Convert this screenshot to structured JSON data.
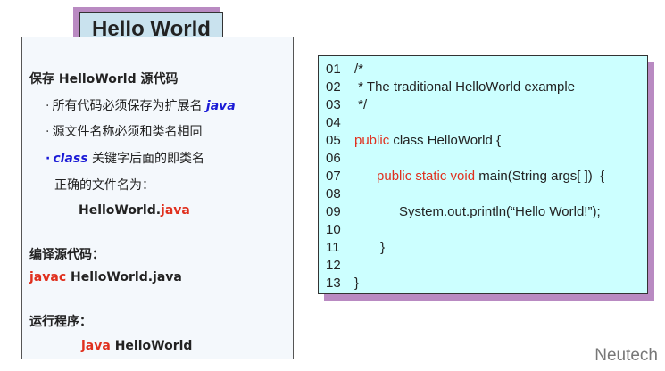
{
  "title": "Hello World",
  "left": {
    "save_heading": "保存 HelloWorld 源代码",
    "bullet1_text": "所有代码必须保存为扩展名 ",
    "bullet1_ext": "java",
    "bullet2_text": "源文件名称必须和类名相同",
    "bullet3_kw": "class",
    "bullet3_text": " 关键字后面的即类名",
    "correct_label": "正确的文件名为：",
    "file_base": "HelloWorld.",
    "file_ext": "java",
    "compile_heading": "编译源代码：",
    "compile_cmd": "javac",
    "compile_arg": " HelloWorld.java",
    "run_heading": "运行程序：",
    "run_cmd": "java",
    "run_arg": " HelloWorld"
  },
  "code": {
    "lines": [
      {
        "num": "01",
        "pre": "/*",
        "kw": "",
        "post": ""
      },
      {
        "num": "02",
        "pre": " * The traditional HelloWorld example",
        "kw": "",
        "post": ""
      },
      {
        "num": "03",
        "pre": " */",
        "kw": "",
        "post": ""
      },
      {
        "num": "04",
        "pre": "",
        "kw": "",
        "post": ""
      },
      {
        "num": "05",
        "pre": "",
        "kw": "public",
        "post": " class HelloWorld {"
      },
      {
        "num": "06",
        "pre": "",
        "kw": "",
        "post": ""
      },
      {
        "num": "07",
        "pre": "      ",
        "kw": "public static void",
        "post": " main(String args[ ])  {"
      },
      {
        "num": "08",
        "pre": "",
        "kw": "",
        "post": ""
      },
      {
        "num": "09",
        "pre": "            System.out.println(“Hello World!”);",
        "kw": "",
        "post": ""
      },
      {
        "num": "10",
        "pre": "",
        "kw": "",
        "post": ""
      },
      {
        "num": "11",
        "pre": "       }",
        "kw": "",
        "post": ""
      },
      {
        "num": "12",
        "pre": "",
        "kw": "",
        "post": ""
      },
      {
        "num": "13",
        "pre": "}",
        "kw": "",
        "post": ""
      }
    ]
  },
  "brand": "Neutech",
  "colors": {
    "keyword": "#e0301e",
    "code_bg": "#ccffff",
    "shadow": "#b98ac2",
    "title_bg": "#c9e2ee"
  }
}
